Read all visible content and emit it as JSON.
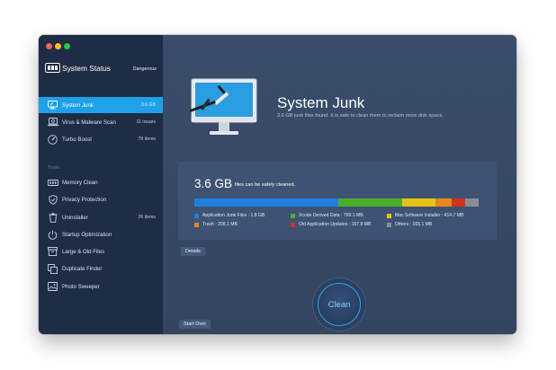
{
  "window": {
    "traffic_lights": [
      "close",
      "minimize",
      "zoom"
    ]
  },
  "sidebar": {
    "title": "System Status",
    "status": "Dangerous",
    "items": [
      {
        "label": "System Junk",
        "value": "3.6 GB",
        "icon": "monitor-icon",
        "active": true
      },
      {
        "label": "Virus & Malware Scan",
        "value": "11 issues",
        "icon": "laptop-scan-icon"
      },
      {
        "label": "Turbo Boost",
        "value": "78 items",
        "icon": "speedometer-icon"
      }
    ],
    "tools_label": "Tools",
    "tools": [
      {
        "label": "Memory Clean",
        "value": "",
        "icon": "memory-chip-icon"
      },
      {
        "label": "Privacy Protection",
        "value": "",
        "icon": "shield-icon"
      },
      {
        "label": "Uninstaller",
        "value": "26 items",
        "icon": "trash-icon"
      },
      {
        "label": "Startup Optimization",
        "value": "",
        "icon": "power-icon"
      },
      {
        "label": "Large & Old Files",
        "value": "",
        "icon": "archive-box-icon"
      },
      {
        "label": "Duplicate Finder",
        "value": "",
        "icon": "copy-icon"
      },
      {
        "label": "Photo Sweeper",
        "value": "",
        "icon": "photo-icon"
      }
    ]
  },
  "main": {
    "title": "System Junk",
    "subtitle": "3.6 GB junk files found.  It is safe to clean them to reclaim more disk space.",
    "summary": {
      "size": "3.6 GB",
      "note": "files can be safely cleaned."
    },
    "breakdown": [
      {
        "label": "Application Junk Files : 1.8 GB",
        "fraction": 0.5,
        "color": "#1f7fe0"
      },
      {
        "label": "Xcode Derived Data : 799.1 MB",
        "fraction": 0.222,
        "color": "#4caf2b"
      },
      {
        "label": "Mac Software Installer : 414.7 MB",
        "fraction": 0.115,
        "color": "#e5c414"
      },
      {
        "label": "Trash : 208.1 MB",
        "fraction": 0.058,
        "color": "#e8881a"
      },
      {
        "label": "Old Application Updates : 167.8 MB",
        "fraction": 0.047,
        "color": "#d0321e"
      },
      {
        "label": "Others : 165.1 MB",
        "fraction": 0.046,
        "color": "#8a8d92"
      }
    ],
    "details_button": "Details",
    "clean_button": "Clean",
    "start_over_button": "Start Over"
  }
}
